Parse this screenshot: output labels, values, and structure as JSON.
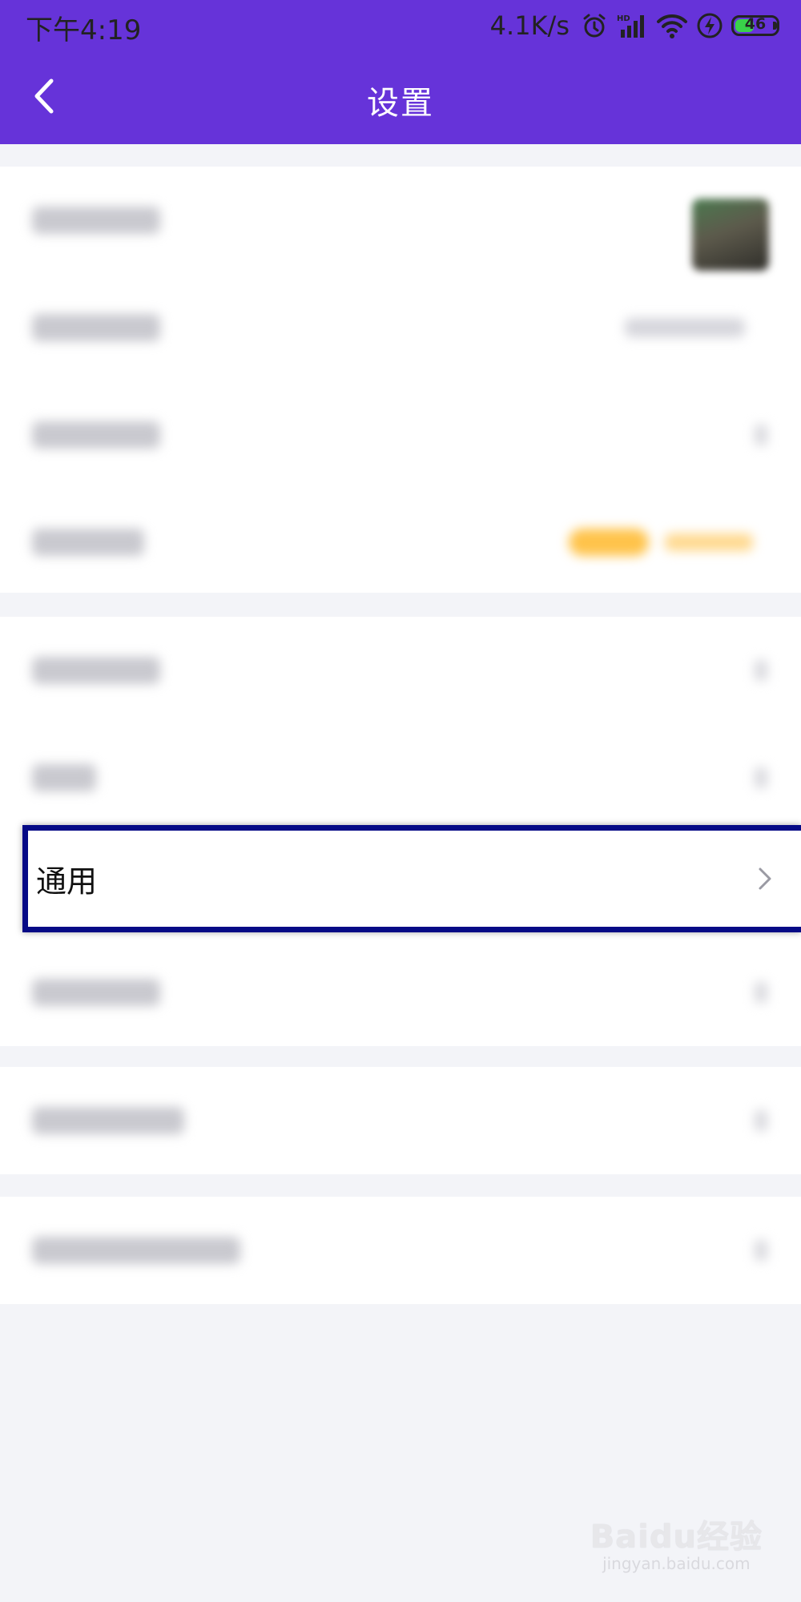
{
  "status_bar": {
    "time": "下午4:19",
    "network_speed": "4.1K/s",
    "battery_level": "46",
    "battery_fraction": 0.46,
    "icons": [
      "alarm-icon",
      "hd-signal-icon",
      "wifi-icon",
      "charging-icon",
      "battery-icon"
    ]
  },
  "nav": {
    "title": "设置",
    "back_icon": "chevron-left-icon"
  },
  "colors": {
    "header_bg": "#6633d9",
    "highlight_border": "#050a86",
    "page_bg": "#f3f4f8",
    "badge": "#ffc34a"
  },
  "settings": {
    "highlighted_item": {
      "label": "通用",
      "icon": "chevron-right-icon"
    }
  },
  "watermark": {
    "logo": "Baidu经验",
    "url": "jingyan.baidu.com"
  }
}
